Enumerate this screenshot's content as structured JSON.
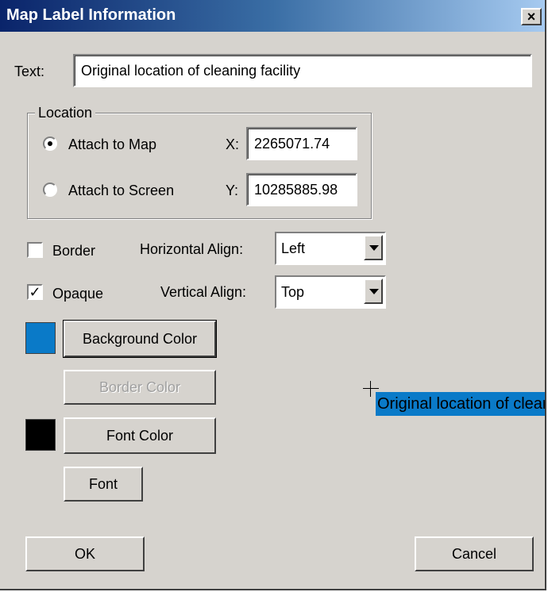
{
  "window": {
    "title": "Map Label Information",
    "close_glyph": "×"
  },
  "text_field": {
    "label": "Text:",
    "value": "Original location of cleaning facility"
  },
  "location": {
    "group_label": "Location",
    "attach_map_label": "Attach to Map",
    "attach_screen_label": "Attach to Screen",
    "attach_map_selected": true,
    "x_label": "X:",
    "x_value": "2265071.74",
    "y_label": "Y:",
    "y_value": "10285885.98"
  },
  "options": {
    "border_label": "Border",
    "border_checked": false,
    "opaque_label": "Opaque",
    "opaque_checked": true,
    "checkmark": "✓",
    "horizontal_align_label": "Horizontal Align:",
    "horizontal_align_value": "Left",
    "vertical_align_label": "Vertical Align:",
    "vertical_align_value": "Top"
  },
  "colors": {
    "background_color_button": "Background Color",
    "border_color_button": "Border Color",
    "font_color_button": "Font Color",
    "font_button": "Font",
    "background_swatch": "#0a7ac8",
    "font_swatch": "#000000"
  },
  "preview": {
    "text": "Original location of cleaning facility",
    "background": "#0a7ac8",
    "color": "#000000"
  },
  "actions": {
    "ok": "OK",
    "cancel": "Cancel"
  }
}
